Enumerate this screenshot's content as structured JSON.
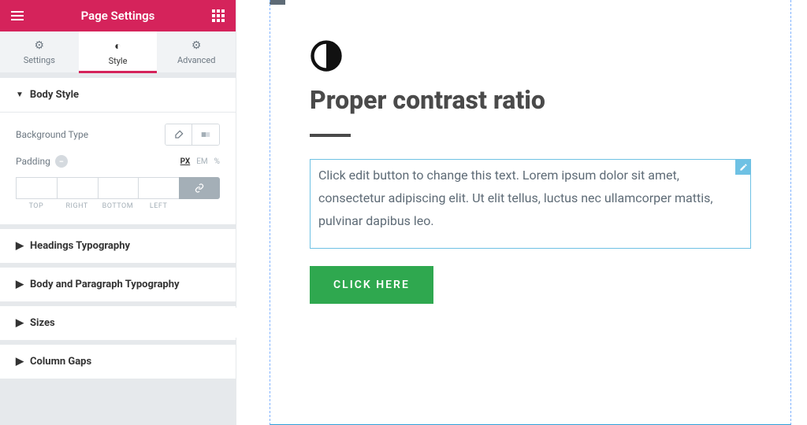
{
  "header": {
    "title": "Page Settings"
  },
  "tabs": {
    "settings": "Settings",
    "style": "Style",
    "advanced": "Advanced"
  },
  "bodyStyle": {
    "title": "Body Style",
    "backgroundTypeLabel": "Background Type",
    "paddingLabel": "Padding",
    "units": {
      "px": "PX",
      "em": "EM",
      "pct": "%"
    },
    "sides": {
      "top": "TOP",
      "right": "RIGHT",
      "bottom": "BOTTOM",
      "left": "LEFT"
    }
  },
  "collapsedSections": {
    "headingsTypography": "Headings Typography",
    "bodyParagraphTypography": "Body and Paragraph Typography",
    "sizes": "Sizes",
    "columnGaps": "Column Gaps"
  },
  "canvas": {
    "heading": "Proper contrast ratio",
    "paragraph": "Click edit button to change this text. Lorem ipsum dolor sit amet, consectetur adipiscing elit. Ut elit tellus, luctus nec ullamcorper mattis, pulvinar dapibus leo.",
    "buttonLabel": "CLICK HERE"
  }
}
